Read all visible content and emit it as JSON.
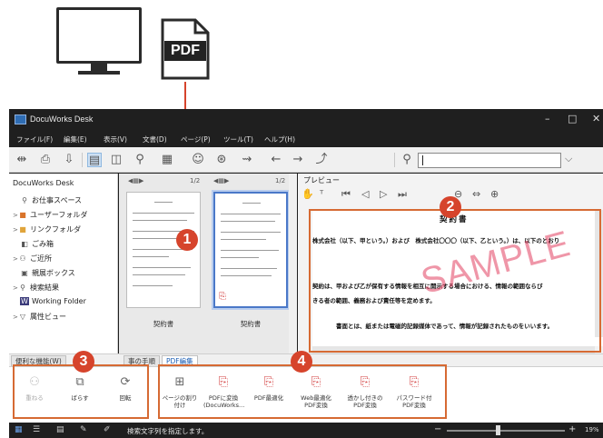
{
  "illustration": {
    "pdf_label": "PDF"
  },
  "window": {
    "title": "DocuWorks Desk",
    "controls": [
      "–",
      "□",
      "✕"
    ]
  },
  "menu": [
    "ファイル(F)",
    "編集(E)",
    "表示(V)",
    "文書(D)",
    "ページ(P)",
    "ツール(T)",
    "ヘルプ(H)"
  ],
  "toolbar": {
    "search_value": ""
  },
  "tree": {
    "items": [
      {
        "label": "DocuWorks Desk",
        "icon": "desk-icon",
        "expand": ""
      },
      {
        "label": "お仕事スペース",
        "icon": "workspace-icon",
        "expand": ""
      },
      {
        "label": "ユーザーフォルダ",
        "icon": "folder-icon",
        "expand": ">"
      },
      {
        "label": "リンクフォルダ",
        "icon": "link-folder-icon",
        "expand": ">"
      },
      {
        "label": "ごみ箱",
        "icon": "trash-icon",
        "expand": ""
      },
      {
        "label": "ご近所",
        "icon": "neighbors-icon",
        "expand": ">"
      },
      {
        "label": "親展ボックス",
        "icon": "confidential-box-icon",
        "expand": ""
      },
      {
        "label": "検索結果",
        "icon": "search-results-icon",
        "expand": ">"
      },
      {
        "label": "Working Folder",
        "icon": "working-folder-icon",
        "expand": ""
      },
      {
        "label": "属性ビュー",
        "icon": "attribute-view-icon",
        "expand": ">"
      }
    ]
  },
  "thumbs": {
    "items": [
      {
        "pages": "1/2",
        "label": "契約書"
      },
      {
        "pages": "1/2",
        "label": "契約書"
      }
    ]
  },
  "preview": {
    "title": "プレビュー",
    "doc_title": "契約書",
    "lines": [
      "株式会社（以下、甲という。）および　株式会社〇〇〇（以下、乙という。）は、以下のとおり",
      "契約は、甲および乙が保有する情報を相互に開示する場合における、情報の範囲ならび",
      "きる者の範囲、義務および責任等を定めます。",
      "書面とは、紙または電磁的記録媒体であって、情報が記録されたものをいいます。"
    ],
    "watermark": "SAMPLE"
  },
  "tabs": [
    "便利な機能(W)",
    "事の手順",
    "PDF編集"
  ],
  "ribbon": {
    "left_group": [
      {
        "label": "重ねる",
        "icon": "stack-icon",
        "enabled": false
      },
      {
        "label": "ばらす",
        "icon": "split-icon",
        "enabled": true
      },
      {
        "label": "回転",
        "icon": "rotate-icon",
        "enabled": true
      }
    ],
    "pdf_group": [
      {
        "label": "ページの割り付け",
        "icon": "page-layout-icon"
      },
      {
        "label": "PDFに変換(DocuWorks...",
        "icon": "pdf-convert-icon"
      },
      {
        "label": "PDF最適化",
        "icon": "pdf-optimize-icon"
      },
      {
        "label": "Web最適化PDF変換",
        "icon": "pdf-web-optimize-icon"
      },
      {
        "label": "透かし付きのPDF変換",
        "icon": "pdf-watermark-icon"
      },
      {
        "label": "パスワード付PDF変換",
        "icon": "pdf-password-icon"
      }
    ]
  },
  "status": {
    "text": "検索文字列を指定します。",
    "zoom": "19%"
  },
  "callouts": [
    "1",
    "2",
    "3",
    "4"
  ],
  "colors": {
    "accent": "#d6442c",
    "highlight": "#d66a33",
    "titlebar": "#1f1f1f",
    "watermark": "#e24060"
  }
}
